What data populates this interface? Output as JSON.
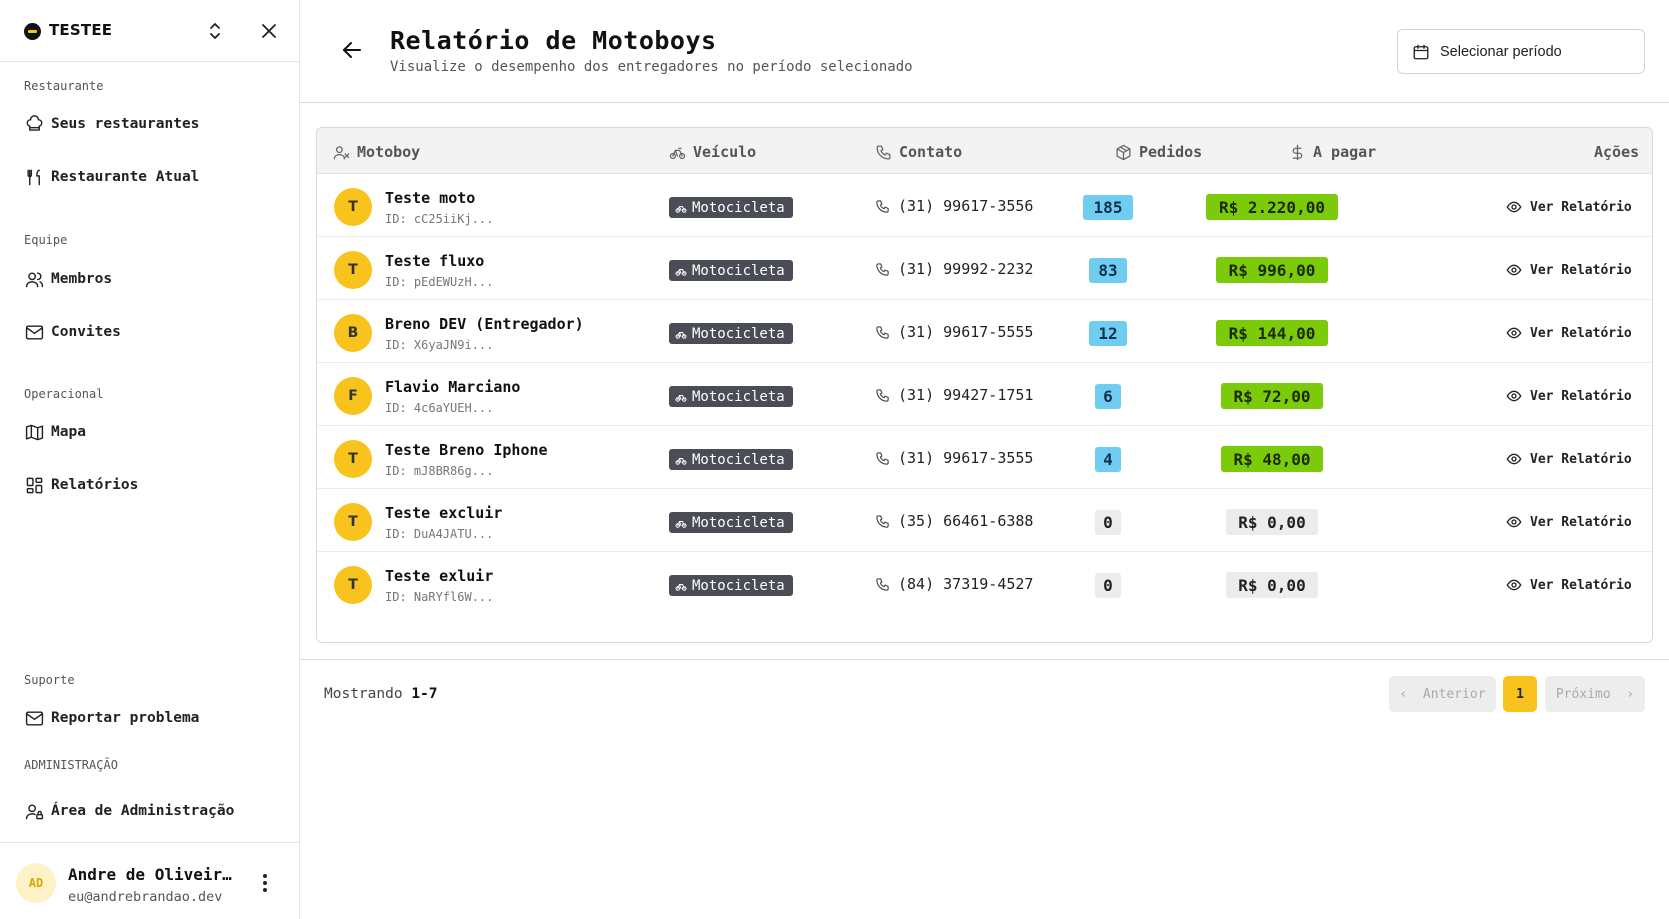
{
  "sidebar": {
    "brand": "TESTEE",
    "sections": {
      "restaurante": "Restaurante",
      "equipe": "Equipe",
      "operacional": "Operacional",
      "suporte": "Suporte",
      "administracao": "ADMINISTRAÇÃO"
    },
    "items": {
      "seus_restaurantes": "Seus restaurantes",
      "restaurante_atual": "Restaurante Atual",
      "membros": "Membros",
      "convites": "Convites",
      "mapa": "Mapa",
      "relatorios": "Relatórios",
      "reportar": "Reportar problema",
      "admin": "Área de Administração"
    },
    "user": {
      "initials": "AD",
      "name": "Andre de Oliveira Brandão",
      "email": "eu@andrebrandao.dev"
    }
  },
  "header": {
    "title": "Relatório de Motoboys",
    "subtitle": "Visualize o desempenho dos entregadores no período selecionado",
    "period_button": "Selecionar período"
  },
  "table": {
    "columns": {
      "motoboy": "Motoboy",
      "veiculo": "Veículo",
      "contato": "Contato",
      "pedidos": "Pedidos",
      "a_pagar": "A pagar",
      "acoes": "Ações"
    },
    "action_label": "Ver Relatório",
    "rows": [
      {
        "initial": "T",
        "name": "Teste moto",
        "id": "ID: cC25iiKj...",
        "vehicle": "Motocicleta",
        "phone": "(31) 99617-3556",
        "orders": "185",
        "pay": "R$ 2.220,00"
      },
      {
        "initial": "T",
        "name": "Teste fluxo",
        "id": "ID: pEdEWUzH...",
        "vehicle": "Motocicleta",
        "phone": "(31) 99992-2232",
        "orders": "83",
        "pay": "R$ 996,00"
      },
      {
        "initial": "B",
        "name": "Breno DEV (Entregador)",
        "id": "ID: X6yaJN9i...",
        "vehicle": "Motocicleta",
        "phone": "(31) 99617-5555",
        "orders": "12",
        "pay": "R$ 144,00"
      },
      {
        "initial": "F",
        "name": "Flavio Marciano",
        "id": "ID: 4c6aYUEH...",
        "vehicle": "Motocicleta",
        "phone": "(31) 99427-1751",
        "orders": "6",
        "pay": "R$ 72,00"
      },
      {
        "initial": "T",
        "name": "Teste Breno Iphone",
        "id": "ID: mJ8BR86g...",
        "vehicle": "Motocicleta",
        "phone": "(31) 99617-3555",
        "orders": "4",
        "pay": "R$ 48,00"
      },
      {
        "initial": "T",
        "name": "Teste excluir",
        "id": "ID: DuA4JATU...",
        "vehicle": "Motocicleta",
        "phone": "(35) 66461-6388",
        "orders": "0",
        "pay": "R$ 0,00"
      },
      {
        "initial": "T",
        "name": "Teste exluir",
        "id": "ID: NaRYfl6W...",
        "vehicle": "Motocicleta",
        "phone": "(84) 37319-4527",
        "orders": "0",
        "pay": "R$ 0,00"
      }
    ]
  },
  "pagination": {
    "showing_label": "Mostrando",
    "range": "1-7",
    "prev": "Anterior",
    "current": "1",
    "next": "Próximo"
  },
  "colors": {
    "accent": "#f8c31d",
    "orders_badge": "#70cdf2",
    "pay_badge": "#7ccb0a",
    "vehicle_badge": "#4a4d55"
  }
}
